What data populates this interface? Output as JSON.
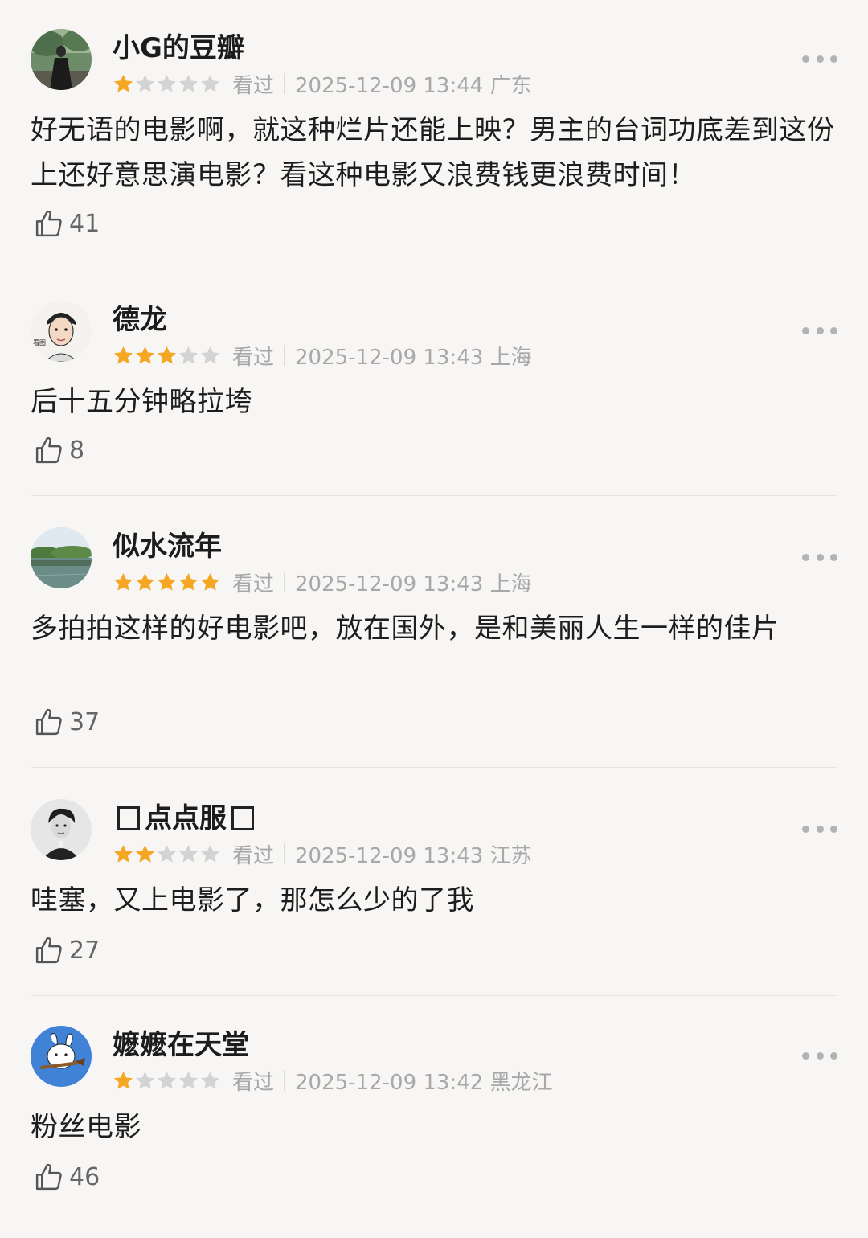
{
  "colors": {
    "star_on": "#f5a623",
    "star_off": "#d3d3d3",
    "meta_text": "#a8a8a8"
  },
  "icons": {
    "more": "more-dots-icon",
    "like": "thumbs-up-icon",
    "star": "star-icon"
  },
  "reviews": [
    {
      "username": "小G的豆瓣",
      "rating": 1,
      "watched_label": "看过",
      "time": "2025-12-09 13:44 广东",
      "content": "好无语的电影啊，就这种烂片还能上映？男主的台词功底差到这份上还好意思演电影？看这种电影又浪费钱更浪费时间！",
      "likes": "41"
    },
    {
      "username": "德龙",
      "rating": 3,
      "watched_label": "看过",
      "time": "2025-12-09 13:43 上海",
      "content": "后十五分钟略拉垮",
      "likes": "8"
    },
    {
      "username": "似水流年",
      "rating": 5,
      "watched_label": "看过",
      "time": "2025-12-09 13:43 上海",
      "content": "多拍拍这样的好电影吧，放在国外，是和美丽人生一样的佳片",
      "likes": "37"
    },
    {
      "username": "点点服",
      "rating": 2,
      "watched_label": "看过",
      "time": "2025-12-09 13:43 江苏",
      "content": "哇塞，又上电影了，那怎么少的了我",
      "likes": "27"
    },
    {
      "username": "嬷嬷在天堂",
      "rating": 1,
      "watched_label": "看过",
      "time": "2025-12-09 13:42 黑龙江",
      "content": "粉丝电影",
      "likes": "46"
    }
  ]
}
